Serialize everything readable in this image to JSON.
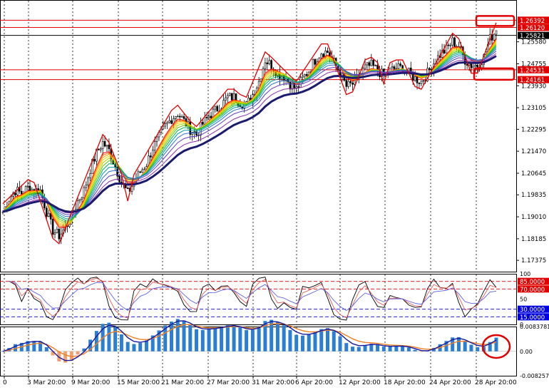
{
  "chart_data": [
    {
      "type": "candlestick",
      "panel": "price",
      "ylim": [
        1.1695,
        1.2715
      ],
      "y_ticks": [
        "1.25580",
        "1.24755",
        "1.23930",
        "1.23105",
        "1.22295",
        "1.21470",
        "1.20645",
        "1.19835",
        "1.19010",
        "1.18185",
        "1.17375"
      ],
      "horizontal_levels": [
        {
          "label": "1.26392",
          "value": 1.26392,
          "color": "#e00000",
          "tag": "red"
        },
        {
          "label": "1.26120",
          "value": 1.2612,
          "color": "#e00000",
          "tag": "red"
        },
        {
          "label": "1.25821",
          "value": 1.25821,
          "color": "#000000",
          "tag": "black"
        },
        {
          "label": "1.24531",
          "value": 1.24531,
          "color": "#e00000",
          "tag": "red"
        },
        {
          "label": "1.24161",
          "value": 1.24161,
          "color": "#e00000",
          "tag": "red"
        }
      ],
      "ribbon_colors": [
        "#ff0000",
        "#ff6600",
        "#ffaa00",
        "#e8d800",
        "#a8d400",
        "#55c800",
        "#00b060",
        "#00a0a0",
        "#3070d0",
        "#6040c0",
        "#9030b0"
      ],
      "zigzag_color": "#e00000",
      "slow_ma_color": "#1a1a6e",
      "candle_color": "#000000",
      "candles": [
        1.192,
        1.197,
        1.2,
        1.199,
        1.201,
        1.2,
        1.2,
        1.192,
        1.185,
        1.183,
        1.186,
        1.19,
        1.196,
        1.2,
        1.208,
        1.214,
        1.218,
        1.215,
        1.209,
        1.203,
        1.199,
        1.203,
        1.207,
        1.21,
        1.216,
        1.22,
        1.224,
        1.227,
        1.229,
        1.226,
        1.223,
        1.221,
        1.225,
        1.228,
        1.23,
        1.232,
        1.235,
        1.235,
        1.233,
        1.232,
        1.236,
        1.241,
        1.249,
        1.247,
        1.244,
        1.243,
        1.24,
        1.238,
        1.242,
        1.245,
        1.249,
        1.252,
        1.252,
        1.248,
        1.244,
        1.239,
        1.24,
        1.243,
        1.246,
        1.247,
        1.245,
        1.243,
        1.245,
        1.246,
        1.246,
        1.244,
        1.242,
        1.241,
        1.244,
        1.248,
        1.251,
        1.253,
        1.256,
        1.254,
        1.249,
        1.247,
        1.247,
        1.25,
        1.257,
        1.26
      ]
    },
    {
      "type": "line",
      "panel": "oscillator",
      "ylim": [
        0,
        100
      ],
      "levels": [
        {
          "label": "85.0000",
          "value": 85,
          "color": "#e00000"
        },
        {
          "label": "70.0000",
          "value": 70,
          "color": "#e00000"
        },
        {
          "label": "30.0000",
          "value": 30,
          "color": "#0000e0"
        },
        {
          "label": "15.0000",
          "value": 15,
          "color": "#0000e0"
        }
      ],
      "y_ticks": [
        "100",
        "50",
        "0"
      ],
      "series_colors": [
        "#000000",
        "#e06060",
        "#6060e0"
      ]
    },
    {
      "type": "histogram",
      "panel": "macd",
      "ylim": [
        -0.0082573,
        0.0083781
      ],
      "y_ticks": [
        "0.0083781",
        "0.00",
        "-0.0082573"
      ],
      "bar_colors": {
        "positive": "#2a7fd4",
        "negative": "#f0a070"
      },
      "line_colors": [
        "#f08020",
        "#1a1aa0"
      ]
    }
  ],
  "x_axis": {
    "ticks": [
      "0",
      "3 Mar 20:00",
      "9 Mar 20:00",
      "15 Mar 20:00",
      "21 Mar 20:00",
      "27 Mar 20:00",
      "31 Mar 20:00",
      "6 Apr 20:00",
      "12 Apr 20:00",
      "18 Apr 20:00",
      "24 Apr 20:00",
      "28 Apr 20:00"
    ]
  },
  "annotations": [
    {
      "kind": "rectangle",
      "color": "#e00000",
      "anchor": "upper resistance zone"
    },
    {
      "kind": "rectangle",
      "color": "#e00000",
      "anchor": "support zone"
    },
    {
      "kind": "circle",
      "color": "#e00000",
      "anchor": "latest MACD bars"
    }
  ]
}
